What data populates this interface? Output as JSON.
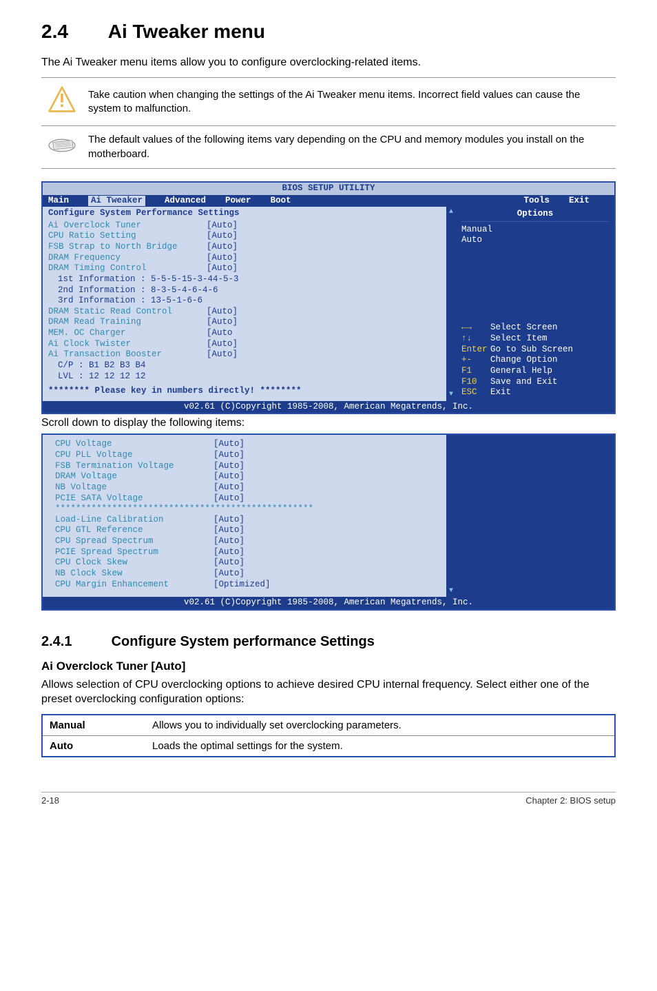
{
  "heading": {
    "number": "2.4",
    "title": "Ai Tweaker menu"
  },
  "intro": "The Ai Tweaker menu items allow you to configure overclocking-related items.",
  "notes": {
    "caution": "Take caution when changing the settings of the Ai Tweaker menu items. Incorrect field values can cause the system to malfunction.",
    "default": "The default values of the following items vary depending on the CPU and memory modules you install on the motherboard."
  },
  "bios": {
    "title": "BIOS SETUP UTILITY",
    "menu": [
      "Main",
      "Ai Tweaker",
      "Advanced",
      "Power",
      "Boot",
      "Tools",
      "Exit"
    ],
    "active_menu_index": 1,
    "section_header": "Configure System Performance Settings",
    "rows1": [
      {
        "label": "Ai Overclock Tuner",
        "val": "[Auto]",
        "cls": "cyan"
      },
      {
        "label": "CPU Ratio Setting",
        "val": "[Auto]",
        "cls": "cyan"
      },
      {
        "label": "FSB Strap to North Bridge",
        "val": "[Auto]",
        "cls": "cyan"
      },
      {
        "label": "DRAM Frequency",
        "val": "[Auto]",
        "cls": "cyan"
      },
      {
        "label": "DRAM Timing Control",
        "val": "[Auto]",
        "cls": "cyan"
      }
    ],
    "info_lines": [
      "1st Information : 5-5-5-15-3-44-5-3",
      "2nd Information : 8-3-5-4-6-4-6",
      "3rd Information : 13-5-1-6-6"
    ],
    "rows2": [
      {
        "label": "DRAM Static Read Control",
        "val": "[Auto]",
        "cls": "cyan"
      },
      {
        "label": "DRAM Read Training",
        "val": "[Auto]",
        "cls": "cyan"
      },
      {
        "label": "MEM. OC Charger",
        "val": "[Auto",
        "cls": "cyan"
      },
      {
        "label": "Ai Clock Twister",
        "val": "[Auto]",
        "cls": "cyan"
      },
      {
        "label": "Ai Transaction Booster",
        "val": "[Auto]",
        "cls": "cyan"
      }
    ],
    "sub_lines": [
      "C/P : B1 B2 B3 B4",
      "LVL : 12 12 12 12"
    ],
    "prompt": "******** Please key in numbers directly! ********",
    "right_title": "Options",
    "options": [
      "Manual",
      "Auto"
    ],
    "hints": [
      {
        "glyph": "←→",
        "text": "Select Screen"
      },
      {
        "glyph": "↑↓",
        "text": "Select Item"
      },
      {
        "glyph": "Enter",
        "text": "Go to Sub Screen"
      },
      {
        "glyph": "+-",
        "text": "Change Option"
      },
      {
        "glyph": "F1",
        "text": "General Help"
      },
      {
        "glyph": "F10",
        "text": "Save and Exit"
      },
      {
        "glyph": "ESC",
        "text": "Exit"
      }
    ],
    "footer": "v02.61 (C)Copyright 1985-2008, American Megatrends, Inc."
  },
  "scroll_caption": "Scroll down to display the following items:",
  "bios2": {
    "rows_top": [
      {
        "label": "CPU Voltage",
        "val": "[Auto]",
        "cls": "cyan"
      },
      {
        "label": "CPU PLL Voltage",
        "val": "[Auto]",
        "cls": "cyan"
      },
      {
        "label": "FSB Termination Voltage",
        "val": "[Auto]",
        "cls": "cyan"
      },
      {
        "label": "DRAM Voltage",
        "val": "[Auto]",
        "cls": "cyan"
      },
      {
        "label": "NB Voltage",
        "val": "[Auto]",
        "cls": "cyan"
      },
      {
        "label": "PCIE SATA Voltage",
        "val": "[Auto]",
        "cls": "cyan"
      }
    ],
    "stars": "**************************************************",
    "rows_bottom": [
      {
        "label": "Load-Line Calibration",
        "val": "[Auto]",
        "cls": "cyan"
      },
      {
        "label": "CPU GTL Reference",
        "val": "[Auto]",
        "cls": "cyan"
      },
      {
        "label": "CPU Spread Spectrum",
        "val": "[Auto]",
        "cls": "cyan"
      },
      {
        "label": "PCIE Spread Spectrum",
        "val": "[Auto]",
        "cls": "cyan"
      },
      {
        "label": "CPU Clock Skew",
        "val": "[Auto]",
        "cls": "cyan"
      },
      {
        "label": "NB Clock Skew",
        "val": "[Auto]",
        "cls": "cyan"
      },
      {
        "label": "CPU Margin Enhancement",
        "val": "[Optimized]",
        "cls": "cyan"
      }
    ],
    "footer": "v02.61 (C)Copyright 1985-2008, American Megatrends, Inc."
  },
  "subsection": {
    "number": "2.4.1",
    "title": "Configure System performance Settings"
  },
  "item1": {
    "title": "Ai Overclock Tuner [Auto]",
    "desc": "Allows selection of CPU overclocking options to achieve desired CPU internal frequency. Select either one of the preset overclocking configuration options:",
    "options": [
      {
        "key": "Manual",
        "text": "Allows you to individually set overclocking parameters."
      },
      {
        "key": "Auto",
        "text": "Loads the optimal settings for the system."
      }
    ]
  },
  "footer": {
    "left": "2-18",
    "right": "Chapter 2: BIOS setup"
  }
}
